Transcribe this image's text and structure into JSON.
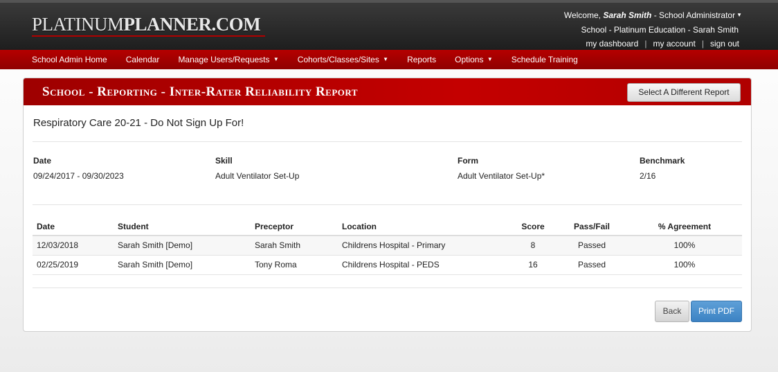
{
  "header": {
    "logo_part1": "PLATINUM",
    "logo_part2": "PLANNER.COM",
    "welcome_prefix": "Welcome,",
    "user_name": "Sarah Smith",
    "user_role": "- School Administrator",
    "school_line": "School - Platinum Education - Sarah Smith",
    "links": [
      "my dashboard",
      "my account",
      "sign out"
    ]
  },
  "nav": {
    "items": [
      {
        "label": "School Admin Home",
        "dropdown": false
      },
      {
        "label": "Calendar",
        "dropdown": false
      },
      {
        "label": "Manage Users/Requests",
        "dropdown": true
      },
      {
        "label": "Cohorts/Classes/Sites",
        "dropdown": true
      },
      {
        "label": "Reports",
        "dropdown": false
      },
      {
        "label": "Options",
        "dropdown": true
      },
      {
        "label": "Schedule Training",
        "dropdown": false
      }
    ]
  },
  "panel": {
    "title": "School - Reporting - Inter-Rater Reliability Report",
    "select_report_button": "Select A Different Report",
    "course_name": "Respiratory Care 20-21 - Do Not Sign Up For!"
  },
  "meta": {
    "date_label": "Date",
    "date_value": "09/24/2017 - 09/30/2023",
    "skill_label": "Skill",
    "skill_value": "Adult Ventilator Set-Up",
    "form_label": "Form",
    "form_value": "Adult Ventilator Set-Up*",
    "benchmark_label": "Benchmark",
    "benchmark_value": "2/16"
  },
  "table": {
    "columns": [
      "Date",
      "Student",
      "Preceptor",
      "Location",
      "Score",
      "Pass/Fail",
      "% Agreement"
    ],
    "rows": [
      [
        "12/03/2018",
        "Sarah Smith [Demo]",
        "Sarah Smith",
        "Childrens Hospital - Primary",
        "8",
        "Passed",
        "100%"
      ],
      [
        "02/25/2019",
        "Sarah Smith [Demo]",
        "Tony Roma",
        "Childrens Hospital - PEDS",
        "16",
        "Passed",
        "100%"
      ]
    ]
  },
  "actions": {
    "back_label": "Back",
    "print_label": "Print PDF"
  },
  "colors": {
    "nav_red": "#a00000",
    "header_dark": "#2a2a2a",
    "print_blue": "#428bca"
  }
}
